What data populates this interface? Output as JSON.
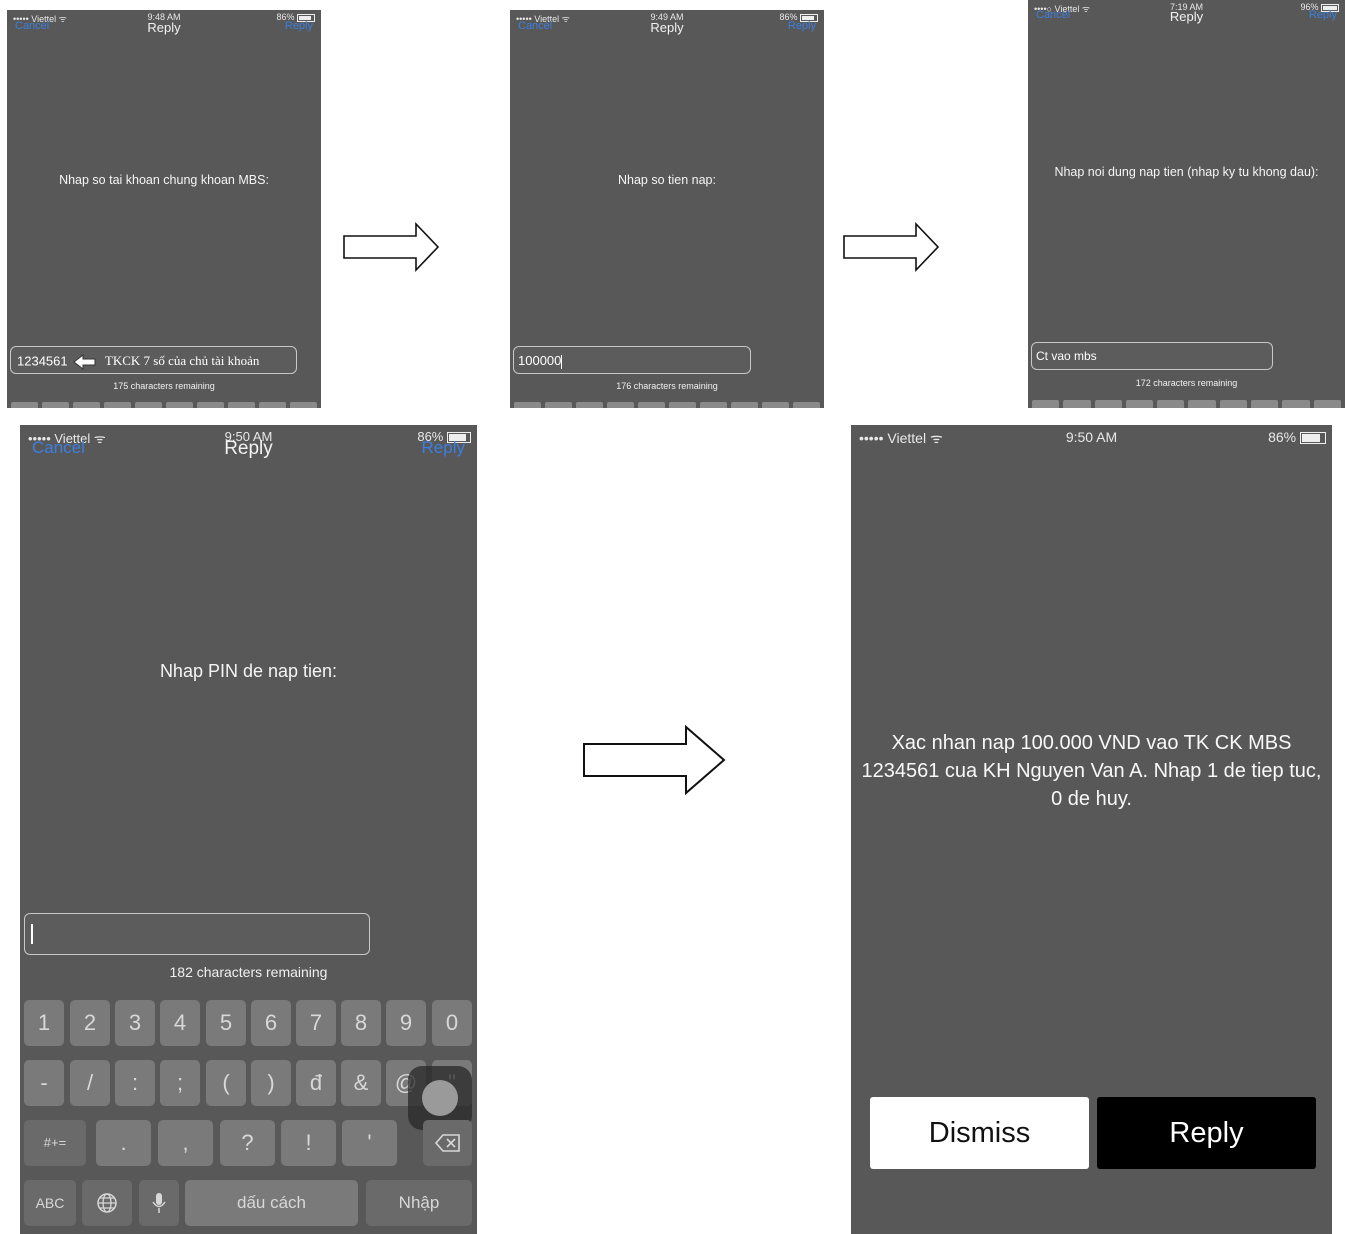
{
  "screen1": {
    "status": {
      "carrier": "••••• Viettel ᯤ",
      "time": "9:48 AM",
      "battery": "86%"
    },
    "nav": {
      "cancel": "Cancel",
      "title": "Reply",
      "reply": "Reply"
    },
    "prompt": "Nhap so tai khoan chung khoan MBS:",
    "input_value": "1234561",
    "annotation": "TKCK 7 số của chủ tài khoản",
    "remaining": "175 characters remaining"
  },
  "screen2": {
    "status": {
      "carrier": "••••• Viettel ᯤ",
      "time": "9:49 AM",
      "battery": "86%"
    },
    "nav": {
      "cancel": "Cancel",
      "title": "Reply",
      "reply": "Reply"
    },
    "prompt": "Nhap so tien nap:",
    "input_value": "100000",
    "remaining": "176 characters remaining"
  },
  "screen3": {
    "status": {
      "carrier": "••••○ Viettel ᯤ",
      "time": "7:19 AM",
      "battery": "96%"
    },
    "nav": {
      "cancel": "Cancel",
      "title": "Reply",
      "reply": "Reply"
    },
    "prompt": "Nhap noi dung nap tien (nhap ky tu khong dau):",
    "input_value": "Ct vao mbs",
    "remaining": "172 characters remaining"
  },
  "screen4": {
    "status": {
      "carrier": "••••• Viettel ᯤ",
      "time": "9:50 AM",
      "battery": "86%"
    },
    "nav": {
      "cancel": "Cancel",
      "title": "Reply",
      "reply": "Reply"
    },
    "prompt": "Nhap PIN de nap tien:",
    "input_value": "",
    "remaining": "182 characters remaining",
    "keyboard": {
      "row1": [
        "1",
        "2",
        "3",
        "4",
        "5",
        "6",
        "7",
        "8",
        "9",
        "0"
      ],
      "row2": [
        "-",
        "/",
        ":",
        ";",
        "(",
        ")",
        "đ",
        "&",
        "@",
        "\""
      ],
      "row3": [
        ".",
        ",",
        "?",
        "!",
        "'"
      ],
      "symbols": "#+=",
      "abc": "ABC",
      "space": "dấu cách",
      "enter": "Nhập"
    }
  },
  "screen5": {
    "status": {
      "carrier": "••••• Viettel ᯤ",
      "time": "9:50 AM",
      "battery": "86%"
    },
    "message": "Xac nhan nap 100.000 VND vao TK CK MBS 1234561 cua KH Nguyen Van A. Nhap 1 de tiep tuc, 0 de huy.",
    "dismiss": "Dismiss",
    "reply": "Reply"
  },
  "colors": {
    "screen_bg": "#585858",
    "link_blue": "#3c7fe0",
    "reply_button_bg": "#000000",
    "dismiss_button_bg": "#ffffff"
  }
}
